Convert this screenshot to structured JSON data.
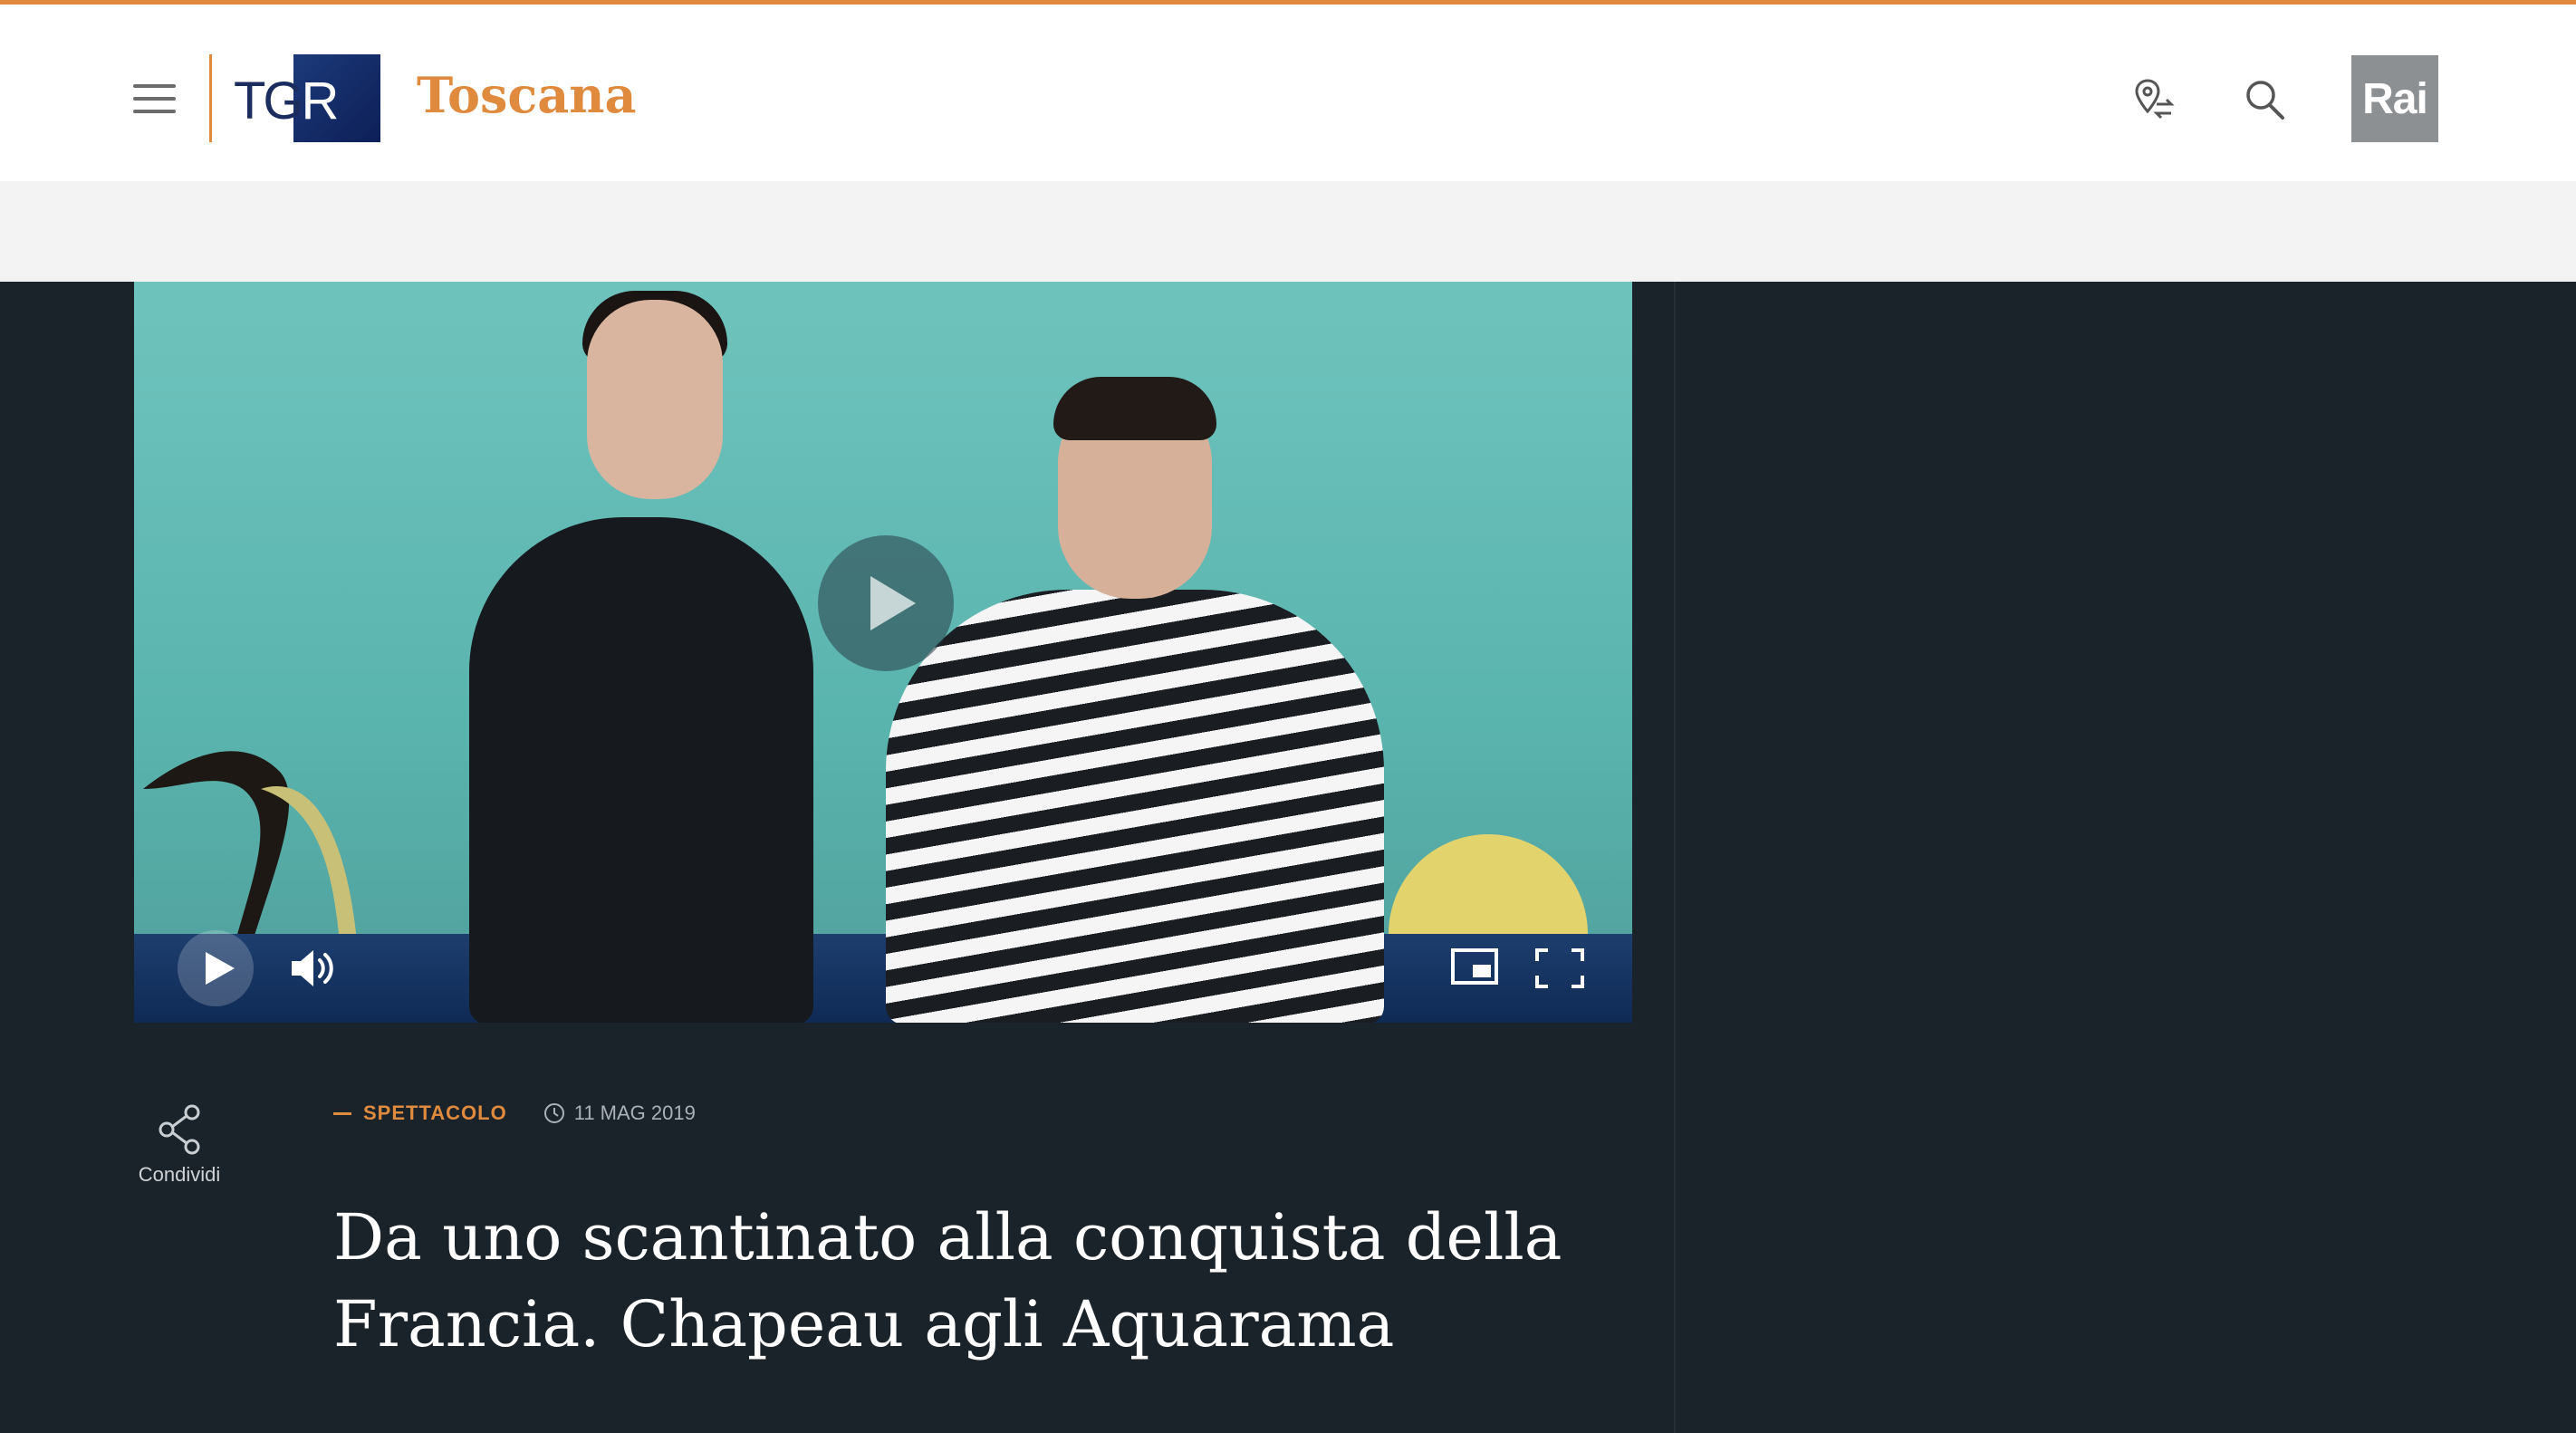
{
  "header": {
    "brand": "TGR",
    "region": "Toscana",
    "rai_logo": "Rai",
    "icons": [
      "menu-icon",
      "location-switch-icon",
      "search-icon"
    ],
    "accent_color": "#e08a3e"
  },
  "video": {
    "controls": [
      "play-icon",
      "volume-icon",
      "picture-in-picture-icon",
      "fullscreen-icon"
    ]
  },
  "article": {
    "share_label": "Condividi",
    "category": "SPETTACOLO",
    "date": "11 MAG 2019",
    "title": "Da uno scantinato alla conquista della Francia. Chapeau agli Aquarama"
  }
}
